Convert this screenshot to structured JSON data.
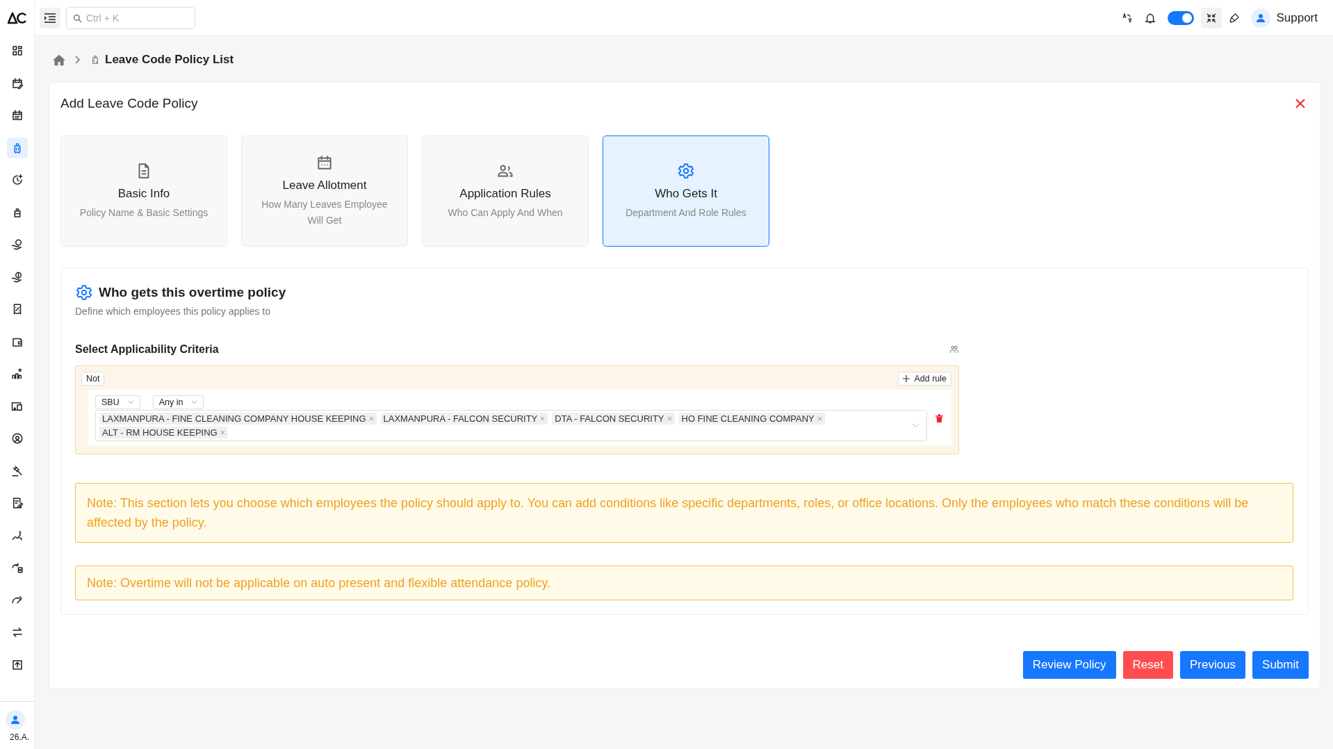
{
  "top_bar": {
    "search": {
      "placeholder": "Ctrl + K"
    },
    "theme_toggle": {
      "on": true
    },
    "user": {
      "name": "Support"
    }
  },
  "sidebar": {
    "items": [
      {
        "selected": false
      },
      {
        "selected": false
      },
      {
        "selected": false
      },
      {
        "selected": true
      },
      {
        "selected": false
      },
      {
        "selected": false
      },
      {
        "selected": false
      },
      {
        "selected": false
      },
      {
        "selected": false
      },
      {
        "selected": false
      },
      {
        "selected": false
      },
      {
        "selected": false
      },
      {
        "selected": false
      },
      {
        "selected": false
      },
      {
        "selected": false
      },
      {
        "selected": false
      },
      {
        "selected": false
      },
      {
        "selected": false
      },
      {
        "selected": false
      },
      {
        "selected": false
      }
    ],
    "user_label": "26.A."
  },
  "breadcrumb": {
    "current": "Leave Code Policy List"
  },
  "dialog": {
    "title": "Add Leave Code Policy"
  },
  "steps": [
    {
      "title": "Basic Info",
      "subtitle": "Policy Name & Basic Settings",
      "selected": false
    },
    {
      "title": "Leave Allotment",
      "subtitle": "How Many Leaves Employee Will Get",
      "selected": false
    },
    {
      "title": "Application Rules",
      "subtitle": "Who Can Apply And When",
      "selected": false
    },
    {
      "title": "Who Gets It",
      "subtitle": "Department And Role Rules",
      "selected": true
    }
  ],
  "section": {
    "title": "Who gets this overtime policy",
    "subtitle": "Define which employees this policy applies to"
  },
  "criteria": {
    "title": "Select Applicability Criteria",
    "not_button": "Not",
    "add_rule_button": "Add rule",
    "rules": [
      {
        "field": "SBU",
        "operator": "Any in",
        "values": [
          "LAXMANPURA - FINE CLEANING COMPANY HOUSE KEEPING",
          "LAXMANPURA - FALCON SECURITY",
          "DTA - FALCON SECURITY",
          "HO FINE CLEANING COMPANY",
          "ALT - RM HOUSE KEEPING"
        ]
      }
    ]
  },
  "notes": [
    "Note: This section lets you choose which employees the policy should apply to. You can add conditions like specific departments, roles, or office locations. Only the employees who match these conditions will be affected by the policy.",
    "Note: Overtime will not be applicable on auto present and flexible attendance policy."
  ],
  "buttons": [
    {
      "label": "Review Policy",
      "kind": "primary"
    },
    {
      "label": "Reset",
      "kind": "danger"
    },
    {
      "label": "Previous",
      "kind": "primary"
    },
    {
      "label": "Submit",
      "kind": "primary"
    }
  ]
}
